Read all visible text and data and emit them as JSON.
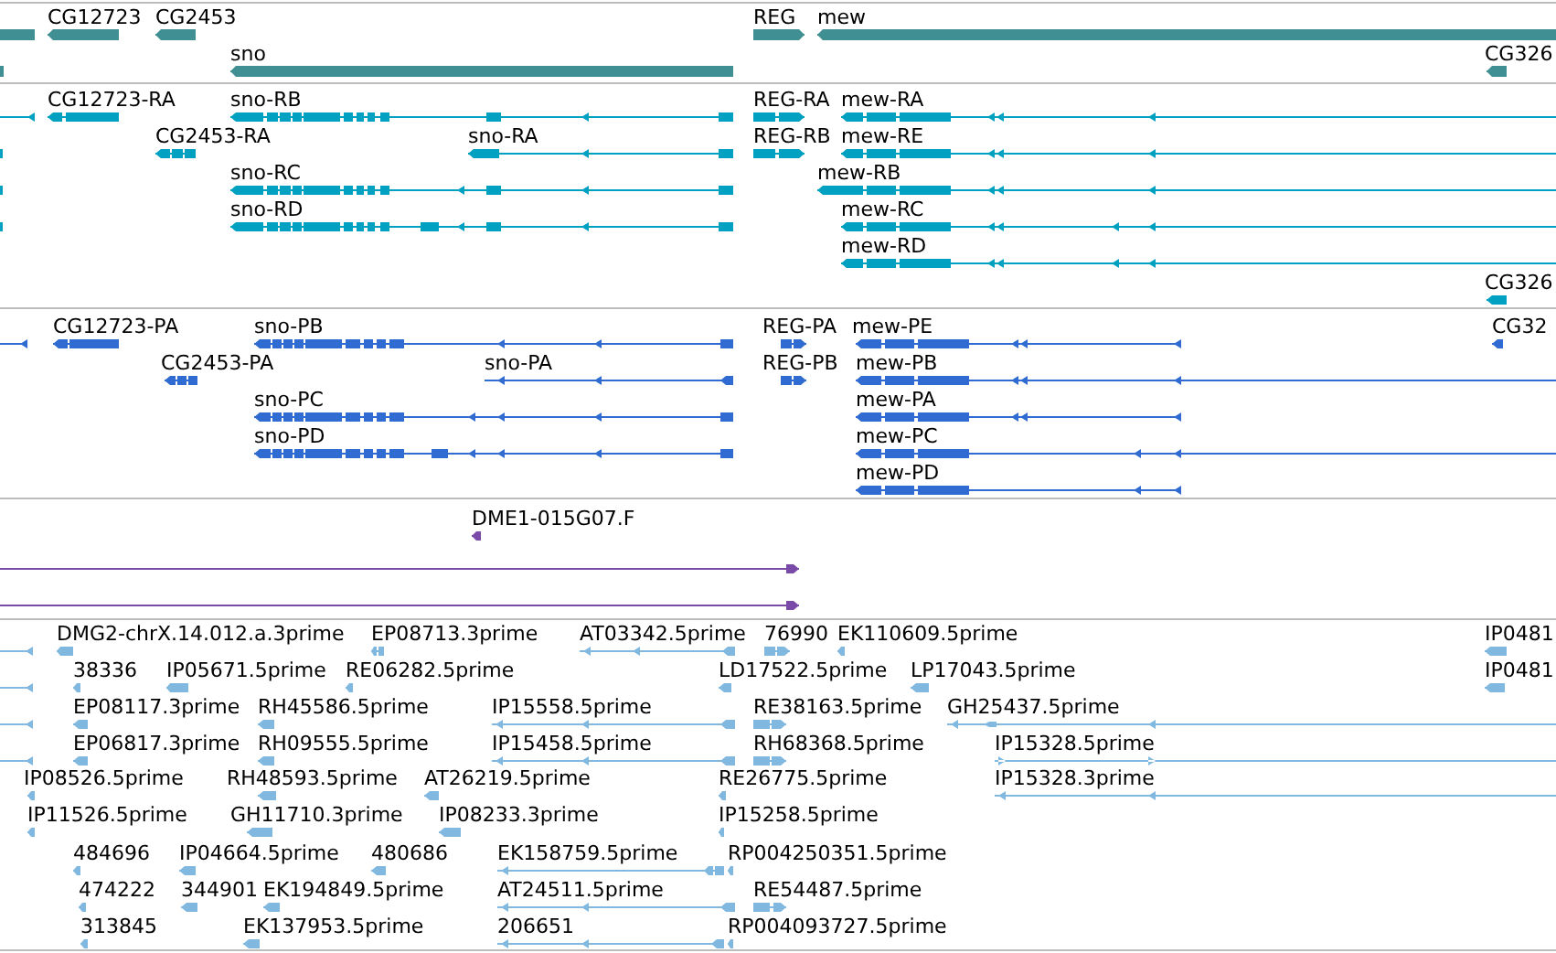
{
  "tracks": [
    {
      "color": "#3f8f93",
      "features": [
        {
          "label": "CG12723"
        },
        {
          "label": "CG2453"
        },
        {
          "label": "sno"
        },
        {
          "label": "REG"
        },
        {
          "label": "mew"
        },
        {
          "label": "CG326"
        }
      ]
    },
    {
      "color": "#00a0c0",
      "features": [
        {
          "label": "CG12723-RA"
        },
        {
          "label": "sno-RB"
        },
        {
          "label": "CG2453-RA"
        },
        {
          "label": "sno-RA"
        },
        {
          "label": "sno-RC"
        },
        {
          "label": "sno-RD"
        },
        {
          "label": "REG-RA"
        },
        {
          "label": "mew-RA"
        },
        {
          "label": "REG-RB"
        },
        {
          "label": "mew-RE"
        },
        {
          "label": "mew-RB"
        },
        {
          "label": "mew-RC"
        },
        {
          "label": "mew-RD"
        },
        {
          "label": "CG326"
        }
      ]
    },
    {
      "color": "#2f6bd1",
      "features": [
        {
          "label": "CG12723-PA"
        },
        {
          "label": "sno-PB"
        },
        {
          "label": "CG2453-PA"
        },
        {
          "label": "sno-PA"
        },
        {
          "label": "sno-PC"
        },
        {
          "label": "sno-PD"
        },
        {
          "label": "REG-PA"
        },
        {
          "label": "mew-PE"
        },
        {
          "label": "REG-PB"
        },
        {
          "label": "mew-PB"
        },
        {
          "label": "mew-PA"
        },
        {
          "label": "mew-PC"
        },
        {
          "label": "mew-PD"
        },
        {
          "label": "CG32"
        }
      ]
    },
    {
      "color": "#7a4aa8",
      "features": [
        {
          "label": "DME1-015G07.F"
        }
      ]
    },
    {
      "color": "#80b8e0",
      "features": [
        {
          "label": "DMG2-chrX.14.012.a.3prime"
        },
        {
          "label": "EP08713.3prime"
        },
        {
          "label": "AT03342.5prime"
        },
        {
          "label": "76990"
        },
        {
          "label": "EK110609.5prime"
        },
        {
          "label": "IP0481"
        },
        {
          "label": "38336"
        },
        {
          "label": "IP05671.5prime"
        },
        {
          "label": "RE06282.5prime"
        },
        {
          "label": "LD17522.5prime"
        },
        {
          "label": "LP17043.5prime"
        },
        {
          "label": "IP0481"
        },
        {
          "label": "EP08117.3prime"
        },
        {
          "label": "RH45586.5prime"
        },
        {
          "label": "IP15558.5prime"
        },
        {
          "label": "RE38163.5prime"
        },
        {
          "label": "GH25437.5prime"
        },
        {
          "label": "EP06817.3prime"
        },
        {
          "label": "RH09555.5prime"
        },
        {
          "label": "IP15458.5prime"
        },
        {
          "label": "RH68368.5prime"
        },
        {
          "label": "IP15328.5prime"
        },
        {
          "label": "IP08526.5prime"
        },
        {
          "label": "RH48593.5prime"
        },
        {
          "label": "AT26219.5prime"
        },
        {
          "label": "RE26775.5prime"
        },
        {
          "label": "IP15328.3prime"
        },
        {
          "label": "IP11526.5prime"
        },
        {
          "label": "GH11710.3prime"
        },
        {
          "label": "IP08233.3prime"
        },
        {
          "label": "IP15258.5prime"
        },
        {
          "label": "484696"
        },
        {
          "label": "IP04664.5prime"
        },
        {
          "label": "480686"
        },
        {
          "label": "EK158759.5prime"
        },
        {
          "label": "RP004250351.5prime"
        },
        {
          "label": "474222"
        },
        {
          "label": "344901"
        },
        {
          "label": "EK194849.5prime"
        },
        {
          "label": "AT24511.5prime"
        },
        {
          "label": "RE54487.5prime"
        },
        {
          "label": "313845"
        },
        {
          "label": "EK137953.5prime"
        },
        {
          "label": "206651"
        },
        {
          "label": "RP004093727.5prime"
        }
      ]
    }
  ]
}
